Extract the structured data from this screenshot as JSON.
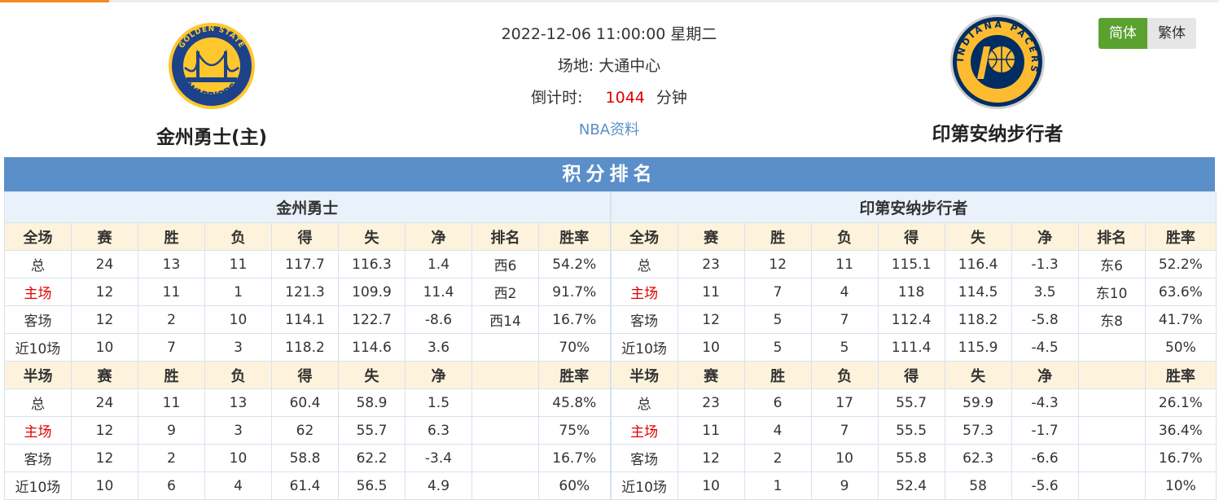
{
  "match": {
    "datetime": "2022-12-06 11:00:00 星期二",
    "venue_label": "场地:",
    "venue": "大通中心",
    "countdown_label": "倒计时:",
    "countdown_value": "1044",
    "countdown_unit": "分钟",
    "nba_link": "NBA资料"
  },
  "home_team": {
    "name": "金州勇士(主)",
    "logo_text_top": "GOLDEN STATE",
    "logo_text_bottom": "WARRIORS",
    "logo_colors": {
      "primary": "#1d428a",
      "secondary": "#ffc72c"
    }
  },
  "away_team": {
    "name": "印第安纳步行者",
    "logo_text": "INDIANA PACERS",
    "logo_colors": {
      "primary": "#002d62",
      "secondary": "#fdbb30"
    }
  },
  "lang": {
    "simplified": "简体",
    "traditional": "繁体"
  },
  "standings": {
    "title": "积分排名",
    "home": {
      "team": "金州勇士",
      "full_headers": [
        "全场",
        "赛",
        "胜",
        "负",
        "得",
        "失",
        "净",
        "排名",
        "胜率"
      ],
      "full_rows": [
        [
          "总",
          "24",
          "13",
          "11",
          "117.7",
          "116.3",
          "1.4",
          "西6",
          "54.2%"
        ],
        [
          "主场",
          "12",
          "11",
          "1",
          "121.3",
          "109.9",
          "11.4",
          "西2",
          "91.7%"
        ],
        [
          "客场",
          "12",
          "2",
          "10",
          "114.1",
          "122.7",
          "-8.6",
          "西14",
          "16.7%"
        ],
        [
          "近10场",
          "10",
          "7",
          "3",
          "118.2",
          "114.6",
          "3.6",
          "",
          "70%"
        ]
      ],
      "half_headers": [
        "半场",
        "赛",
        "胜",
        "负",
        "得",
        "失",
        "净",
        "",
        "胜率"
      ],
      "half_rows": [
        [
          "总",
          "24",
          "11",
          "13",
          "60.4",
          "58.9",
          "1.5",
          "",
          "45.8%"
        ],
        [
          "主场",
          "12",
          "9",
          "3",
          "62",
          "55.7",
          "6.3",
          "",
          "75%"
        ],
        [
          "客场",
          "12",
          "2",
          "10",
          "58.8",
          "62.2",
          "-3.4",
          "",
          "16.7%"
        ],
        [
          "近10场",
          "10",
          "6",
          "4",
          "61.4",
          "56.5",
          "4.9",
          "",
          "60%"
        ]
      ]
    },
    "away": {
      "team": "印第安纳步行者",
      "full_headers": [
        "全场",
        "赛",
        "胜",
        "负",
        "得",
        "失",
        "净",
        "排名",
        "胜率"
      ],
      "full_rows": [
        [
          "总",
          "23",
          "12",
          "11",
          "115.1",
          "116.4",
          "-1.3",
          "东6",
          "52.2%"
        ],
        [
          "主场",
          "11",
          "7",
          "4",
          "118",
          "114.5",
          "3.5",
          "东10",
          "63.6%"
        ],
        [
          "客场",
          "12",
          "5",
          "7",
          "112.4",
          "118.2",
          "-5.8",
          "东8",
          "41.7%"
        ],
        [
          "近10场",
          "10",
          "5",
          "5",
          "111.4",
          "115.9",
          "-4.5",
          "",
          "50%"
        ]
      ],
      "half_headers": [
        "半场",
        "赛",
        "胜",
        "负",
        "得",
        "失",
        "净",
        "",
        "胜率"
      ],
      "half_rows": [
        [
          "总",
          "23",
          "6",
          "17",
          "55.7",
          "59.9",
          "-4.3",
          "",
          "26.1%"
        ],
        [
          "主场",
          "11",
          "4",
          "7",
          "55.5",
          "57.3",
          "-1.7",
          "",
          "36.4%"
        ],
        [
          "客场",
          "12",
          "2",
          "10",
          "55.8",
          "62.3",
          "-6.6",
          "",
          "16.7%"
        ],
        [
          "近10场",
          "10",
          "1",
          "9",
          "52.4",
          "58",
          "-5.6",
          "",
          "10%"
        ]
      ]
    }
  }
}
